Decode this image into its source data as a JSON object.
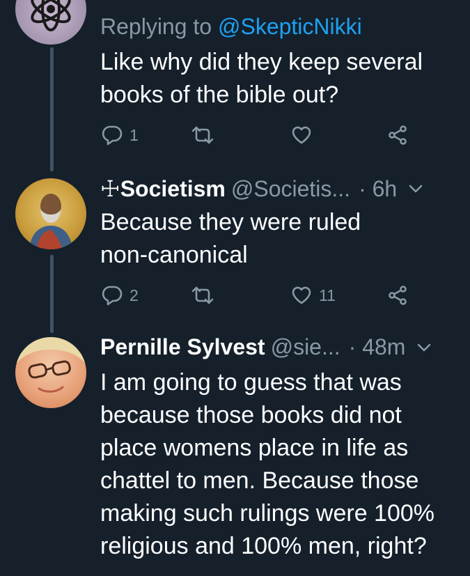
{
  "tweets": [
    {
      "reply_prefix": "Replying to",
      "reply_mention": "@SkepticNikki",
      "text": "Like why did they keep several books of the bible out?",
      "replies": "1",
      "retweets": "",
      "likes": ""
    },
    {
      "cross": "☩",
      "name": "Societism",
      "handle": "@Societis...",
      "time": "· 6h",
      "text": "Because they were ruled non-canonical",
      "replies": "2",
      "retweets": "",
      "likes": "11"
    },
    {
      "name": "Pernille Sylvest",
      "handle": "@sie...",
      "time": "· 48m",
      "text": "I am going to guess that was because those books did not place womens place in life as chattel to men. Because those making such rulings were 100% religious and 100% men, right?"
    }
  ],
  "colors": {
    "background": "#15202b",
    "secondary_text": "#8899a6",
    "mention": "#1da1f2",
    "thread_line": "#3d5466"
  },
  "icons": [
    "reply-icon",
    "retweet-icon",
    "like-icon",
    "share-icon",
    "chevron-down-icon"
  ]
}
